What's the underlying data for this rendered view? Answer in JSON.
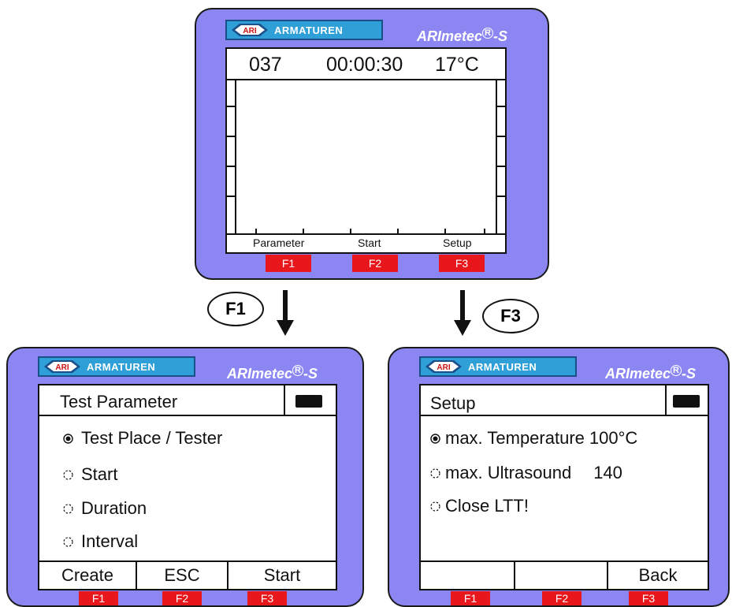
{
  "logo": {
    "company": "ARMATUREN",
    "mark": "ARI"
  },
  "brand": {
    "name": "ARImetec",
    "suffix": "-S",
    "registered": "R"
  },
  "top_device": {
    "counter": "037",
    "time": "00:00:30",
    "temperature": "17°C",
    "softkeys": [
      "Parameter",
      "Start",
      "Setup"
    ],
    "fkeys": [
      "F1",
      "F2",
      "F3"
    ]
  },
  "arrows": {
    "left": "F1",
    "right": "F3"
  },
  "left_device": {
    "title": "Test Parameter",
    "items": [
      {
        "label": "Test Place / Tester",
        "selected": true
      },
      {
        "label": "Start",
        "selected": false
      },
      {
        "label": "Duration",
        "selected": false
      },
      {
        "label": "Interval",
        "selected": false
      }
    ],
    "softkeys": [
      "Create",
      "ESC",
      "Start"
    ],
    "fkeys": [
      "F1",
      "F2",
      "F3"
    ]
  },
  "right_device": {
    "title": "Setup",
    "items": [
      {
        "label": "max. Temperature",
        "value": "100°C",
        "selected": true
      },
      {
        "label": "max. Ultrasound",
        "value": "140",
        "selected": false
      },
      {
        "label": "Close LTT!",
        "value": "",
        "selected": false
      }
    ],
    "softkeys": [
      "",
      "",
      "Back"
    ],
    "fkeys": [
      "F1",
      "F2",
      "F3"
    ]
  },
  "colors": {
    "device": "#8b86f2",
    "logo": "#2f9fd8",
    "fkey": "#e8171c"
  }
}
